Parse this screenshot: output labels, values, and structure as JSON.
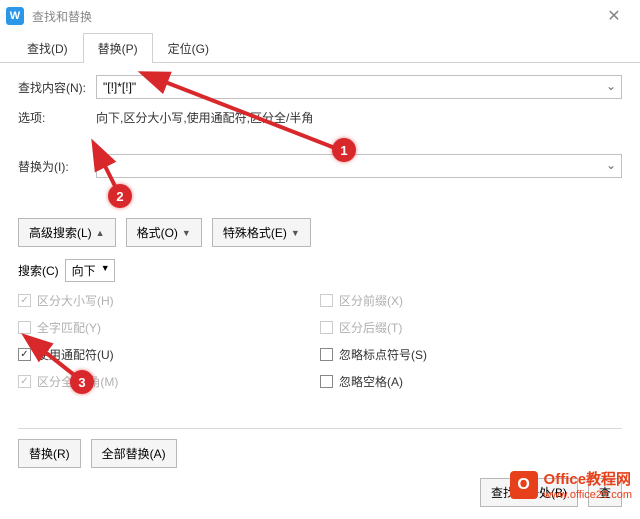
{
  "title": "查找和替换",
  "tabs": {
    "find": "查找(D)",
    "replace": "替换(P)",
    "goto": "定位(G)"
  },
  "labels": {
    "find_content": "查找内容(N):",
    "options": "选项:",
    "replace_with": "替换为(I):",
    "search": "搜索(C)"
  },
  "find_value": "\"[!]*[!]\"",
  "options_text": "向下,区分大小写,使用通配符,区分全/半角",
  "replace_value": "",
  "search_dir": "向下",
  "buttons": {
    "advanced": "高级搜索(L)",
    "format": "格式(O)",
    "special": "特殊格式(E)",
    "replace": "替换(R)",
    "replace_all": "全部替换(A)",
    "find_prev": "查找上一处(B)",
    "find_next_partial": "查"
  },
  "checks": {
    "match_case": "区分大小写(H)",
    "whole_word": "全字匹配(Y)",
    "wildcards": "使用通配符(U)",
    "fullhalf": "区分全/半角(M)",
    "prefix": "区分前缀(X)",
    "suffix": "区分后缀(T)",
    "ignore_punct": "忽略标点符号(S)",
    "ignore_space": "忽略空格(A)"
  },
  "bubbles": {
    "b1": "1",
    "b2": "2",
    "b3": "3"
  },
  "watermark": {
    "line1": "Office教程网",
    "line2": "www.office26.com"
  }
}
